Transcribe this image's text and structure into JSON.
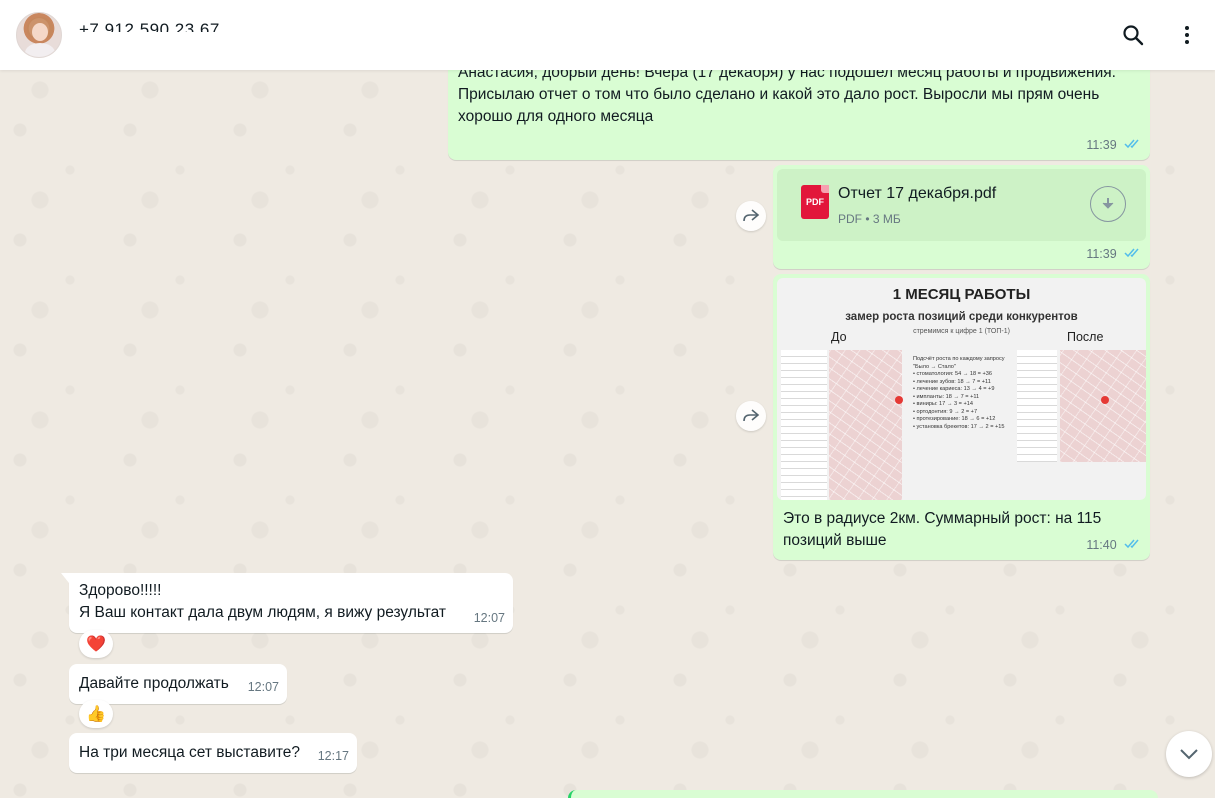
{
  "header": {
    "contact_name": "+7 912 590 23 67",
    "search_icon": "search-icon",
    "menu_icon": "more-vertical-icon"
  },
  "colors": {
    "outgoing_bubble": "#d9fdd3",
    "incoming_bubble": "#ffffff",
    "read_ticks": "#53bdeb",
    "chat_background": "#efeae2",
    "pdf_red": "#e2163b"
  },
  "messages": [
    {
      "direction": "out",
      "text_lines": [
        "Анастасия, добрый день! Вчера (17 декабря) у нас подошел месяц работы и продвижения.",
        "Присылаю отчет о том что было сделано и какой это дало рост. Выросли мы прям очень хорошо для одного месяца"
      ],
      "time": "11:39",
      "status": "read"
    },
    {
      "direction": "out",
      "file_name": "Отчет 17 декабря.pdf",
      "file_type_label": "PDF",
      "file_info": "PDF • 3 МБ",
      "time": "11:39",
      "status": "read"
    },
    {
      "direction": "out",
      "image": {
        "title": "1 МЕСЯЦ РАБОТЫ",
        "subtitle": "замер роста позиций среди конкурентов",
        "subtitle2": "стремимся к цифре 1 (ТОП-1)",
        "label_before": "До",
        "label_after": "После",
        "lines": [
          "Подсчёт роста по каждому запросу",
          "\"Было → Стало\"",
          "• стоматология: 54 → 18 = +36",
          "• лечение зубов: 18 → 7 = +11",
          "• лечение кариеса: 13 → 4 = +9",
          "• импланты: 18 → 7 = +11",
          "• виниры: 17 → 3 = +14",
          "• ортодонтия: 9 → 2 = +7",
          "• протезирование: 18 → 6 = +12",
          "• установка брекетов: 17 → 2 = +15"
        ]
      },
      "caption": "Это в радиусе 2км. Суммарный рост: на 115 позиций выше",
      "time": "11:40",
      "status": "read"
    },
    {
      "direction": "in",
      "text_lines": [
        "Здорово!!!!!",
        "Я Ваш контакт дала двум людям, я вижу результат"
      ],
      "time": "12:07",
      "reaction": "❤️"
    },
    {
      "direction": "in",
      "text": "Давайте продолжать",
      "time": "12:07",
      "reaction": "👍"
    },
    {
      "direction": "in",
      "text": "На три месяца сет выставите?",
      "time": "12:17"
    }
  ]
}
